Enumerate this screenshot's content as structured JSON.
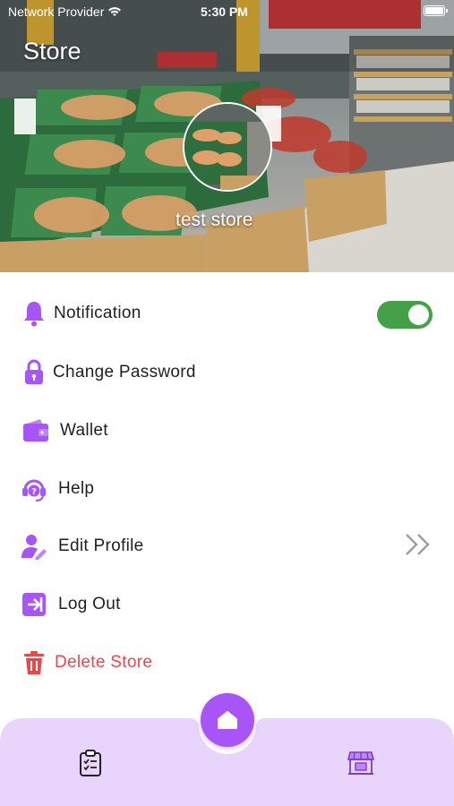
{
  "status_bar": {
    "carrier": "Network Provider",
    "time": "5:30 PM"
  },
  "header": {
    "title": "Store",
    "store_name": "test store"
  },
  "menu": {
    "items": [
      {
        "label": "Notification",
        "icon": "bell-icon"
      },
      {
        "label": "Change Password",
        "icon": "lock-icon"
      },
      {
        "label": "Wallet",
        "icon": "wallet-icon"
      },
      {
        "label": "Help",
        "icon": "headset-icon"
      },
      {
        "label": "Edit Profile",
        "icon": "user-edit-icon"
      },
      {
        "label": "Log Out",
        "icon": "logout-icon"
      },
      {
        "label": "Delete Store",
        "icon": "trash-icon"
      }
    ],
    "notification_enabled": true
  },
  "bottom_nav": {
    "items": [
      {
        "name": "orders",
        "icon": "clipboard-icon"
      },
      {
        "name": "home",
        "icon": "home-icon"
      },
      {
        "name": "store",
        "icon": "storefront-icon"
      }
    ]
  },
  "colors": {
    "accent": "#a855f7",
    "accent_light": "#e9d5fb",
    "toggle_on": "#43a047",
    "danger": "#e8484a",
    "text": "#1f1f1f"
  }
}
